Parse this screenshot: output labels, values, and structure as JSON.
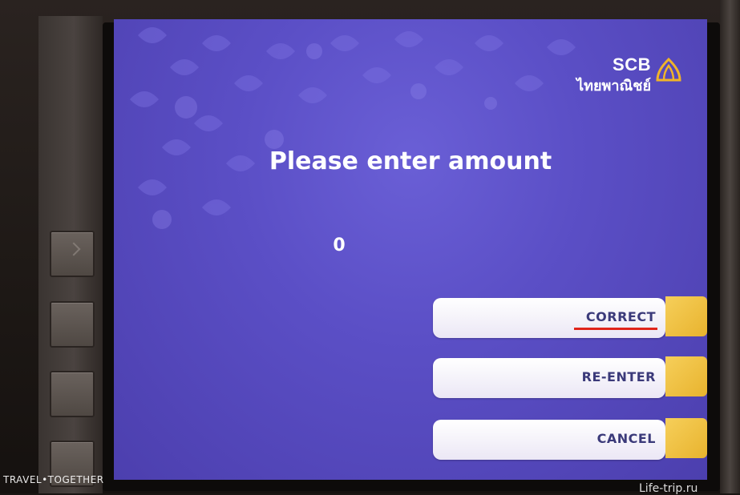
{
  "brand": {
    "name": "SCB",
    "subtitle": "ไทยพาณิชย์",
    "accent_color": "#f0b429",
    "logo_icon": "scb-shell-logo-icon"
  },
  "prompt": {
    "title": "Please enter amount",
    "amount_value": "0"
  },
  "options": [
    {
      "label": "CORRECT",
      "icon": "side-key-tab"
    },
    {
      "label": "RE-ENTER",
      "icon": "side-key-tab"
    },
    {
      "label": "CANCEL",
      "icon": "side-key-tab"
    }
  ],
  "watermarks": {
    "left": "TRAVEL•TOGETHER",
    "right": "Life-trip.ru"
  },
  "colors": {
    "screen_background": "#5b4fc6",
    "button_text": "#3b3a7a",
    "button_tab": "#f0b429",
    "highlight_underline": "#e0241a"
  }
}
